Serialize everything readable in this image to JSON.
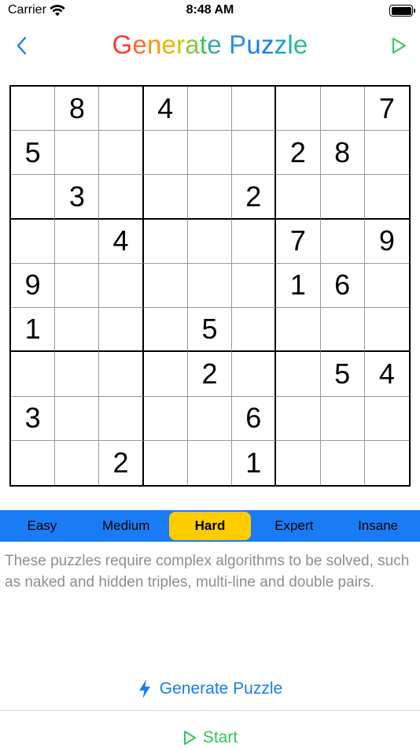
{
  "status_bar": {
    "carrier": "Carrier",
    "time": "8:48 AM",
    "wifi_icon": "wifi-icon",
    "battery_icon": "battery-icon"
  },
  "nav": {
    "title": "Generate Puzzle",
    "back_icon": "chevron-left-icon",
    "play_icon": "play-icon",
    "title_colors": [
      "#ff3b30",
      "#ff6a2e",
      "#ff9500",
      "#f2b200",
      "#d4c300",
      "#8fc43a",
      "#34c759",
      "#3aa8a0",
      "#2f8fe0",
      "#1a7cf5",
      "#1a7cf5",
      "#1aa3c8",
      "#22b0a8",
      "#2cbb8f",
      "#34c759"
    ],
    "accent": "#1a7cf5",
    "play_color": "#34c759"
  },
  "grid": {
    "rows": [
      [
        "",
        "8",
        "",
        "4",
        "",
        "",
        "",
        "",
        "7"
      ],
      [
        "5",
        "",
        "",
        "",
        "",
        "",
        "2",
        "8",
        ""
      ],
      [
        "",
        "3",
        "",
        "",
        "",
        "2",
        "",
        "",
        ""
      ],
      [
        "",
        "",
        "4",
        "",
        "",
        "",
        "7",
        "",
        "9"
      ],
      [
        "9",
        "",
        "",
        "",
        "",
        "",
        "1",
        "6",
        ""
      ],
      [
        "1",
        "",
        "",
        "",
        "5",
        "",
        "",
        "",
        ""
      ],
      [
        "",
        "",
        "",
        "",
        "2",
        "",
        "",
        "5",
        "4"
      ],
      [
        "3",
        "",
        "",
        "",
        "",
        "6",
        "",
        "",
        ""
      ],
      [
        "",
        "",
        "2",
        "",
        "",
        "1",
        "",
        "",
        ""
      ]
    ]
  },
  "difficulty": {
    "options": [
      "Easy",
      "Medium",
      "Hard",
      "Expert",
      "Insane"
    ],
    "selected": "Hard",
    "bar_color": "#1a7cf5",
    "selected_color": "#ffcc00"
  },
  "description": "These puzzles require complex algorithms to be solved, such as naked and hidden triples, multi-line and double pairs.",
  "actions": {
    "generate_label": "Generate Puzzle",
    "generate_icon": "lightning-bolt-icon",
    "start_label": "Start",
    "start_icon": "play-icon",
    "start_color": "#34c759"
  }
}
